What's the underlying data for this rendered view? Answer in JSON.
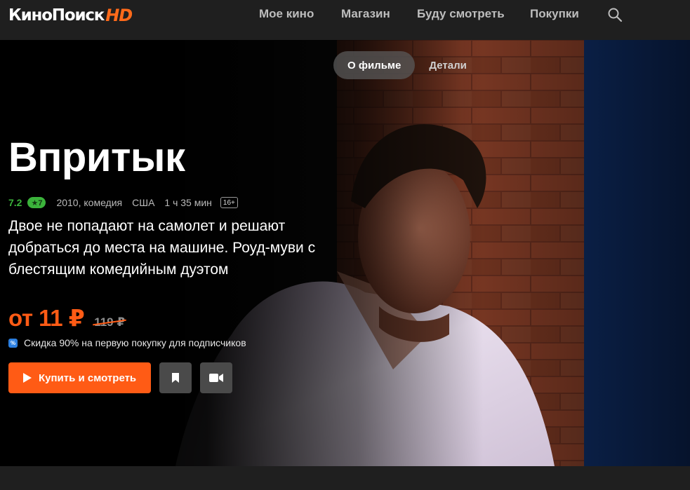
{
  "header": {
    "logo_text": "КиноПоиск",
    "logo_hd": "HD",
    "nav": [
      "Мое кино",
      "Магазин",
      "Буду смотреть",
      "Покупки"
    ],
    "search_icon": "search-icon"
  },
  "tabs": {
    "active": "О фильме",
    "other": "Детали"
  },
  "movie": {
    "title": "Впритык",
    "rating": "7.2",
    "score_badge": "★7",
    "year_genre": "2010, комедия",
    "country": "США",
    "duration": "1 ч 35 мин",
    "age": "16+",
    "description": "Двое не попадают на самолет и решают добраться до места на машине. Роуд-муви с блестящим комедийным дуэтом"
  },
  "price": {
    "current": "от 11 ₽",
    "old": "119 ₽",
    "discount_icon_text": "%",
    "discount_text": "Скидка 90% на первую покупку для подписчиков"
  },
  "actions": {
    "buy_label": "Купить и смотреть",
    "bookmark_icon": "bookmark-icon",
    "trailer_icon": "video-camera-icon"
  },
  "colors": {
    "accent": "#ff5b15",
    "rating_green": "#3bb33b",
    "header_bg": "#1f1f1f"
  }
}
